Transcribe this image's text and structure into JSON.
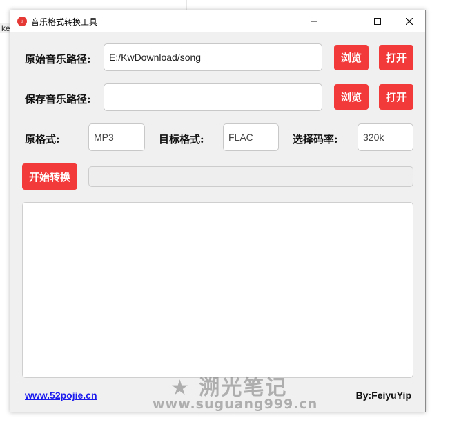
{
  "background": {
    "fragment_text": "ke"
  },
  "window": {
    "title": "音乐格式转换工具",
    "icon": "music-note-icon",
    "controls": {
      "minimize": "minimize-icon",
      "maximize": "maximize-icon",
      "close": "close-icon"
    }
  },
  "source": {
    "label": "原始音乐路径:",
    "value": "E:/KwDownload/song",
    "browse_label": "浏览",
    "open_label": "打开"
  },
  "target": {
    "label": "保存音乐路径:",
    "value": "",
    "browse_label": "浏览",
    "open_label": "打开"
  },
  "formats": {
    "source_format_label": "原格式:",
    "source_format_value": "MP3",
    "target_format_label": "目标格式:",
    "target_format_value": "FLAC",
    "bitrate_label": "选择码率:",
    "bitrate_value": "320k"
  },
  "convert": {
    "start_label": "开始转换",
    "progress_percent": 0
  },
  "log": {
    "text": ""
  },
  "footer": {
    "link_text": "www.52pojie.cn",
    "author": "By:FeiyuYip"
  },
  "watermark": {
    "line1": "★ 溯光笔记",
    "line2": "www.suguang999.cn"
  },
  "colors": {
    "accent": "#f23a3a",
    "link": "#1a1aee"
  }
}
